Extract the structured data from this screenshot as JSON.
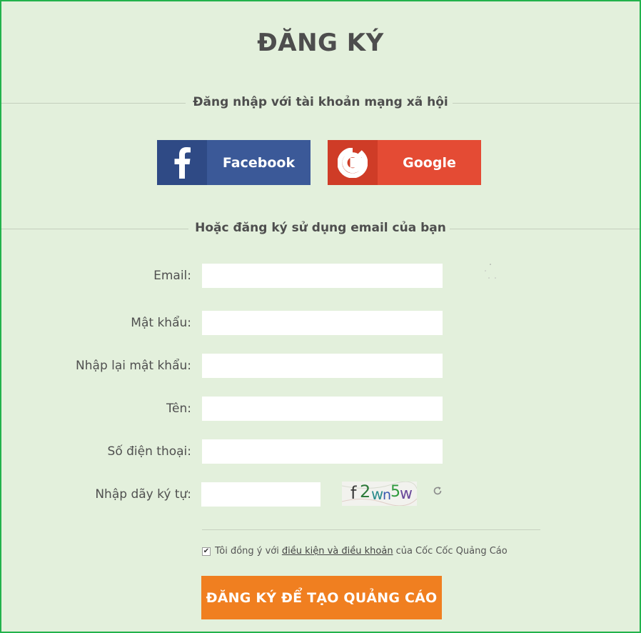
{
  "page": {
    "title": "ĐĂNG KÝ",
    "social_heading": "Đăng nhập với tài khoản mạng xã hội",
    "email_heading": "Hoặc đăng ký sử dụng email của bạn"
  },
  "social": {
    "facebook": {
      "label": "Facebook",
      "icon": "facebook-icon",
      "color": "#3b5998"
    },
    "google": {
      "label": "Google",
      "icon": "google-icon",
      "color": "#e44b34"
    }
  },
  "form": {
    "email_label": "Email:",
    "password_label": "Mật khẩu:",
    "confirm_label": "Nhập lại mật khẩu:",
    "name_label": "Tên:",
    "phone_label": "Số điện thoại:",
    "captcha_label": "Nhập dãy ký tự:",
    "captcha_text": "f2wn5w",
    "email_value": "",
    "password_value": "",
    "confirm_value": "",
    "name_value": "",
    "phone_value": "",
    "captcha_value": ""
  },
  "agreement": {
    "checked": true,
    "prefix": "Tôi đồng ý với",
    "link": "điều kiện và điều khoản",
    "suffix": "của Cốc Cốc Quảng Cáo"
  },
  "submit": {
    "label": "ĐĂNG KÝ ĐỂ TẠO QUẢNG CÁO",
    "color": "#f07f20"
  },
  "theme": {
    "background": "#e3f0dc",
    "border": "#22b24c"
  }
}
